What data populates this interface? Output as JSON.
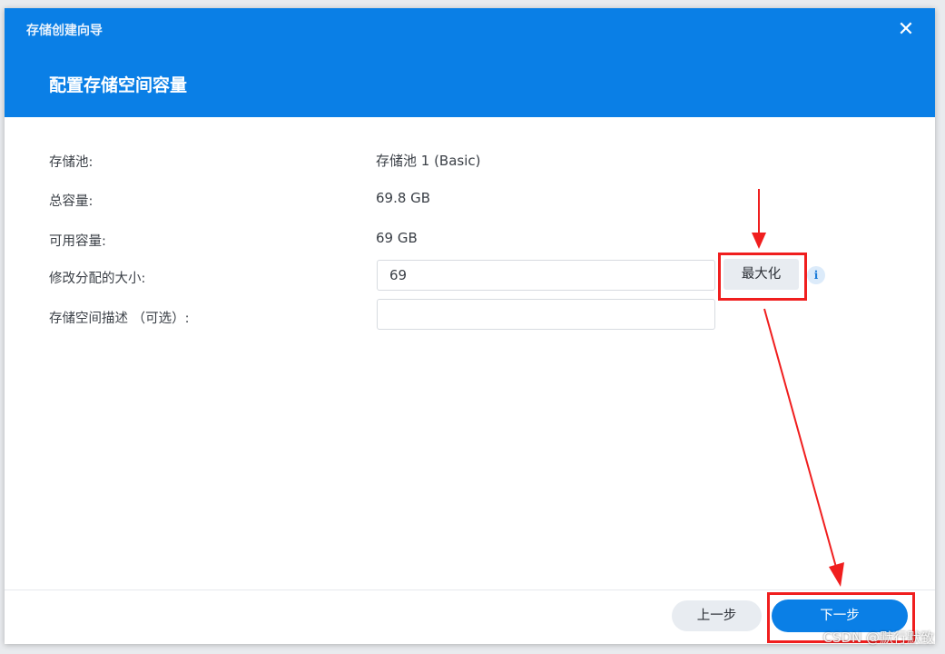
{
  "window": {
    "title": "存储创建向导",
    "close_icon": "close-icon",
    "step_title": "配置存储空间容量"
  },
  "form": {
    "pool_label": "存储池:",
    "pool_value": "存储池 1 (Basic)",
    "total_label": "总容量:",
    "total_value": "69.8 GB",
    "available_label": "可用容量:",
    "available_value": "69 GB",
    "size_label": "修改分配的大小:",
    "size_value": "69",
    "maximize_label": "最大化",
    "info_icon": "info-icon",
    "desc_label": "存储空间描述 （可选）:",
    "desc_value": ""
  },
  "footer": {
    "prev_label": "上一步",
    "next_label": "下一步"
  },
  "annotations": {
    "highlight_color": "#f01e1e"
  },
  "watermark": "CSDN @默行默致",
  "colors": {
    "accent": "#0a7fe6",
    "secondary_button": "#e8ecf1"
  }
}
